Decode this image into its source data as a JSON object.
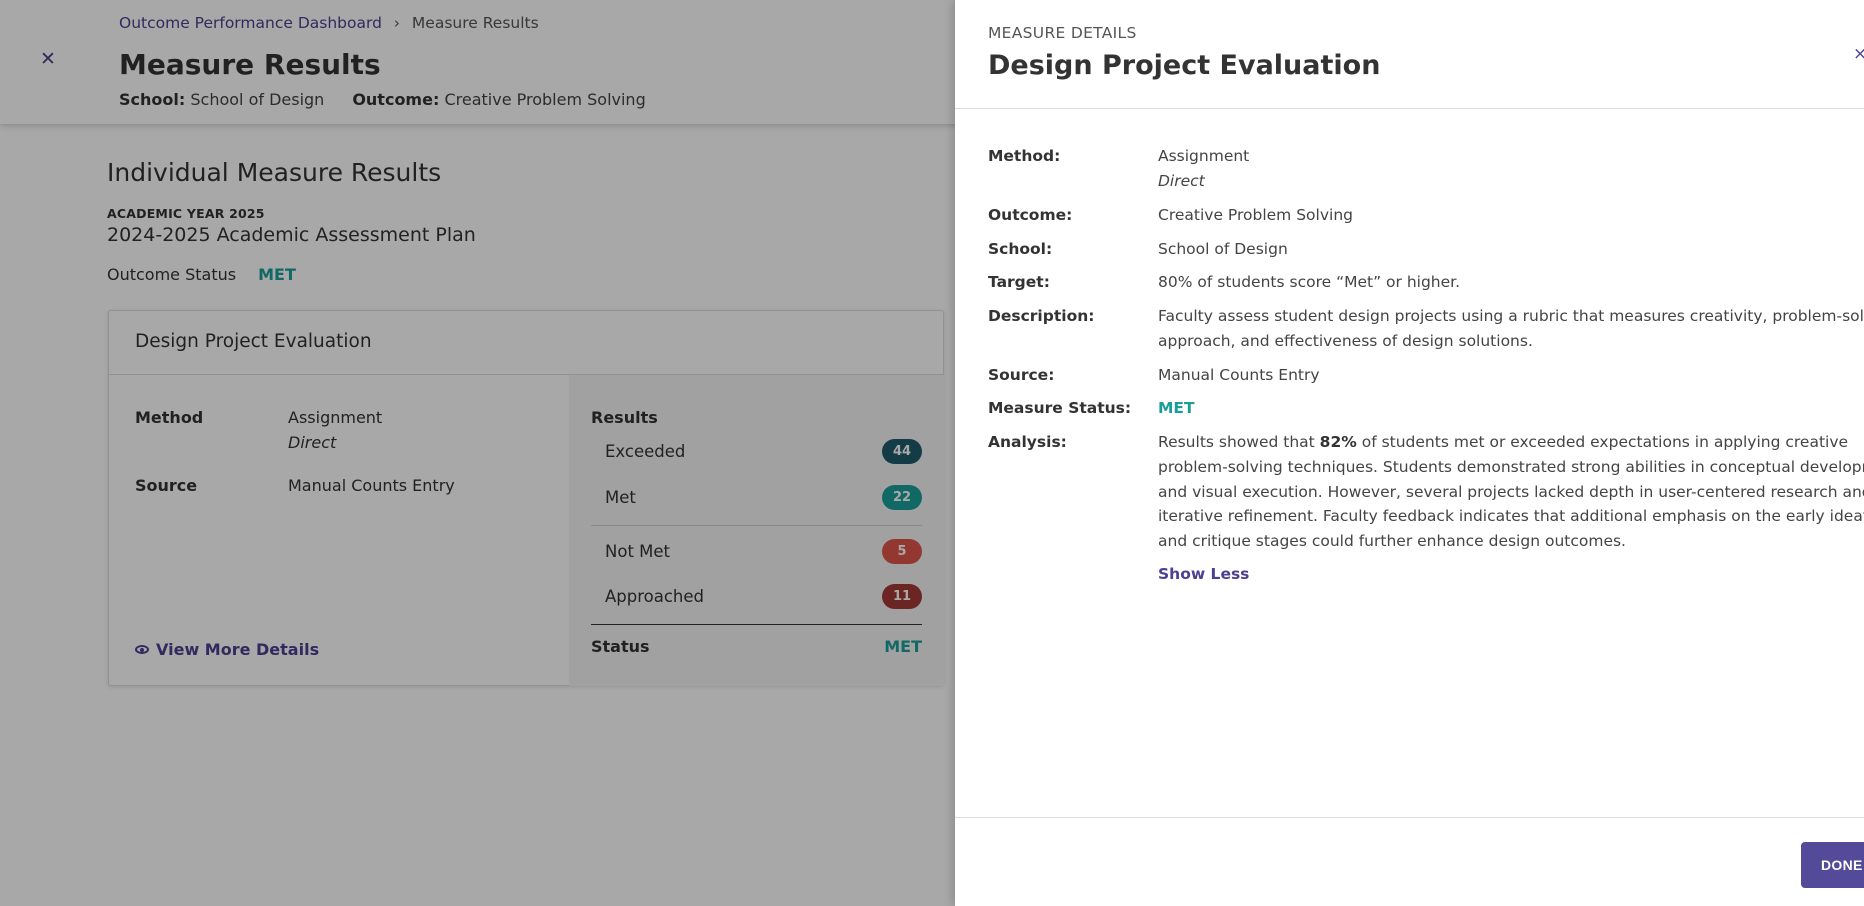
{
  "breadcrumb": {
    "link": "Outcome Performance Dashboard",
    "separator": "›",
    "current": "Measure Results"
  },
  "header": {
    "title": "Measure Results",
    "school_label": "School:",
    "school_value": "School of Design",
    "outcome_label": "Outcome:",
    "outcome_value": "Creative Problem Solving"
  },
  "main": {
    "section_title": "Individual Measure Results",
    "academic_year": "ACADEMIC YEAR 2025",
    "plan_name": "2024-2025 Academic Assessment Plan",
    "outcome_status_label": "Outcome Status",
    "outcome_status_value": "MET"
  },
  "card": {
    "title": "Design Project Evaluation",
    "method_label": "Method",
    "method_value": "Assignment",
    "method_type": "Direct",
    "source_label": "Source",
    "source_value": "Manual Counts Entry",
    "view_more": "View More Details",
    "results_title": "Results",
    "results": [
      {
        "label": "Exceeded",
        "count": "44",
        "color": "#1e5b6b"
      },
      {
        "label": "Met",
        "count": "22",
        "color": "#1b9e9a"
      },
      {
        "label": "Not Met",
        "count": "5",
        "color": "#e0554b"
      },
      {
        "label": "Approached",
        "count": "11",
        "color": "#a33a36"
      }
    ],
    "status_label": "Status",
    "status_value": "MET"
  },
  "drawer": {
    "eyebrow": "MEASURE DETAILS",
    "title": "Design Project Evaluation",
    "close": "×",
    "method_label": "Method:",
    "method_value": "Assignment",
    "method_type": "Direct",
    "outcome_label": "Outcome:",
    "outcome_value": "Creative Problem Solving",
    "school_label": "School:",
    "school_value": "School of Design",
    "target_label": "Target:",
    "target_value": "80% of students score “Met” or higher.",
    "description_label": "Description:",
    "description_line1": "Faculty assess student design projects using a rubric that measures creativity, problem-solving",
    "description_line2": "approach, and effectiveness of design solutions.",
    "source_label": "Source:",
    "source_value": "Manual Counts Entry",
    "status_label": "Measure Status:",
    "status_value": "MET",
    "analysis_label": "Analysis:",
    "analysis_prefix": "Results showed that",
    "analysis_percent": "82%",
    "analysis_line1_rest": "of students met or exceeded expectations in applying creative",
    "analysis_line2": "problem-solving techniques. Students demonstrated strong abilities in conceptual development",
    "analysis_line3": "and visual execution. However, several projects lacked depth in user-centered research and",
    "analysis_line4": "iterative refinement. Faculty feedback indicates that additional emphasis on the early ideation",
    "analysis_line5": "and critique stages could further enhance design outcomes.",
    "show_less": "Show Less",
    "done": "DONE"
  },
  "colors": {
    "accent": "#4b4190",
    "met": "#1b9e9a",
    "button": "#534a9a"
  }
}
